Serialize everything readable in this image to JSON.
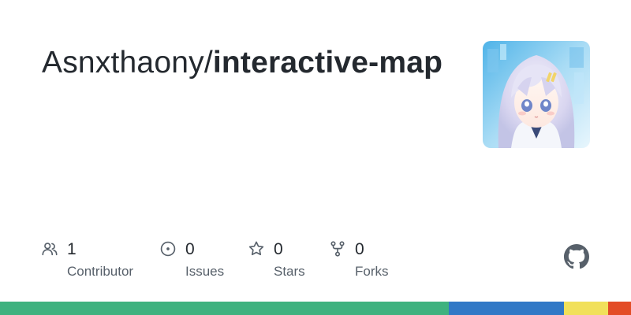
{
  "repo": {
    "owner": "Asnxthaony",
    "separator": "/",
    "name": "interactive-map"
  },
  "avatar": {
    "icon": "anime-avatar-image"
  },
  "stats": {
    "contributors": {
      "value": "1",
      "label": "Contributor",
      "icon": "people-icon"
    },
    "issues": {
      "value": "0",
      "label": "Issues",
      "icon": "issue-opened-icon"
    },
    "stars": {
      "value": "0",
      "label": "Stars",
      "icon": "star-icon"
    },
    "forks": {
      "value": "0",
      "label": "Forks",
      "icon": "repo-forked-icon"
    }
  },
  "brand": {
    "icon": "github-mark-icon"
  },
  "language_bar": [
    {
      "color": "#3fb27f",
      "share": 0.712
    },
    {
      "color": "#3178c6",
      "share": 0.182
    },
    {
      "color": "#f1e05a",
      "share": 0.07
    },
    {
      "color": "#e34c26",
      "share": 0.036
    }
  ],
  "colors": {
    "text_primary": "#24292f",
    "text_secondary": "#57606a"
  }
}
